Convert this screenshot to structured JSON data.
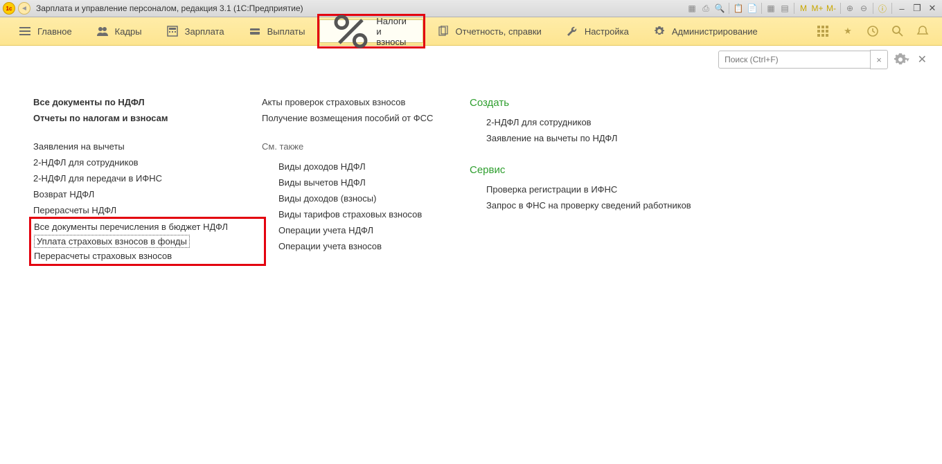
{
  "window_title": "Зарплата и управление персоналом, редакция 3.1  (1С:Предприятие)",
  "titlebar_icons": {
    "m": "M",
    "mp": "M+",
    "mm": "M-"
  },
  "menu": {
    "main": "Главное",
    "staff": "Кадры",
    "salary": "Зарплата",
    "payments": "Выплаты",
    "taxes": "Налоги и взносы",
    "reports": "Отчетность, справки",
    "settings": "Настройка",
    "admin": "Администрирование"
  },
  "search": {
    "placeholder": "Поиск (Ctrl+F)",
    "clear": "×"
  },
  "col1": {
    "h1": "Все документы по НДФЛ",
    "h2": "Отчеты по налогам и взносам",
    "i1": "Заявления на вычеты",
    "i2": "2-НДФЛ для сотрудников",
    "i3": "2-НДФЛ для передачи в ИФНС",
    "i4": "Возврат НДФЛ",
    "i5": "Перерасчеты НДФЛ",
    "i6": "Все документы перечисления в бюджет НДФЛ",
    "i7": "Уплата страховых взносов в фонды",
    "i8": "Перерасчеты страховых взносов"
  },
  "col2": {
    "i1": "Акты проверок страховых взносов",
    "i2": "Получение возмещения пособий от ФСС",
    "see_also": "См. также",
    "s1": "Виды доходов НДФЛ",
    "s2": "Виды вычетов НДФЛ",
    "s3": "Виды доходов (взносы)",
    "s4": "Виды тарифов страховых взносов",
    "s5": "Операции учета НДФЛ",
    "s6": "Операции учета взносов"
  },
  "col3": {
    "create": "Создать",
    "c1": "2-НДФЛ для сотрудников",
    "c2": "Заявление на вычеты по НДФЛ",
    "service": "Сервис",
    "sv1": "Проверка регистрации в ИФНС",
    "sv2": "Запрос в ФНС на проверку сведений работников"
  }
}
